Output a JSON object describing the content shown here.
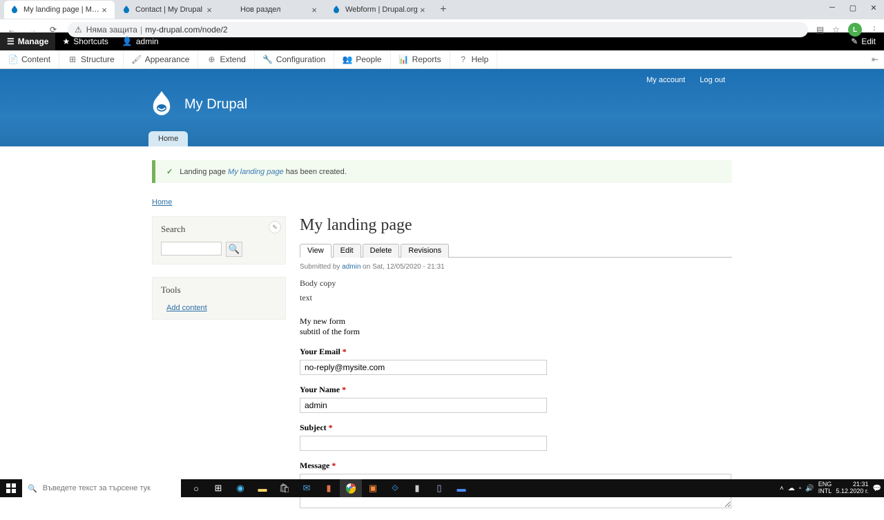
{
  "browser": {
    "tabs": [
      {
        "title": "My landing page | My Drupal",
        "active": true
      },
      {
        "title": "Contact | My Drupal",
        "active": false
      },
      {
        "title": "Нов раздел",
        "active": false
      },
      {
        "title": "Webform | Drupal.org",
        "active": false
      }
    ],
    "url_warning": "Няма защита",
    "url": "my-drupal.com/node/2",
    "profile_letter": "L"
  },
  "toolbar": {
    "manage": "Manage",
    "shortcuts": "Shortcuts",
    "admin": "admin",
    "edit": "Edit"
  },
  "admin_menu": {
    "content": "Content",
    "structure": "Structure",
    "appearance": "Appearance",
    "extend": "Extend",
    "configuration": "Configuration",
    "people": "People",
    "reports": "Reports",
    "help": "Help"
  },
  "header": {
    "my_account": "My account",
    "log_out": "Log out",
    "site_name": "My Drupal",
    "home_tab": "Home"
  },
  "status": {
    "prefix": "Landing page ",
    "link": "My landing page",
    "suffix": " has been created."
  },
  "breadcrumb": {
    "home": "Home"
  },
  "sidebar": {
    "search_title": "Search",
    "tools_title": "Tools",
    "add_content": "Add content"
  },
  "page": {
    "title": "My landing page",
    "tabs": {
      "view": "View",
      "edit": "Edit",
      "delete": "Delete",
      "revisions": "Revisions"
    },
    "submitted_prefix": "Submitted by ",
    "submitted_user": "admin",
    "submitted_suffix": " on Sat, 12/05/2020 - 21:31",
    "body1": "Body copy",
    "body2": "text",
    "form_title": "My new form",
    "form_subtitle": "subtitl of the form",
    "email_label": "Your Email",
    "email_value": "no-reply@mysite.com",
    "name_label": "Your Name",
    "name_value": "admin",
    "subject_label": "Subject",
    "message_label": "Message"
  },
  "taskbar": {
    "search_placeholder": "Въведете текст за търсене тук",
    "lang1": "ENG",
    "lang2": "INTL",
    "time": "21:31",
    "date": "5.12.2020 г."
  }
}
